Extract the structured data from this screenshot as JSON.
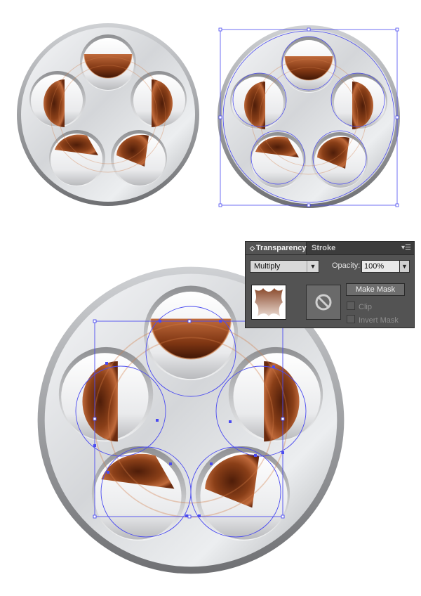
{
  "transparency_panel": {
    "tab_active": "Transparency",
    "tab_inactive": "Stroke",
    "blend_mode": "Multiply",
    "opacity_label": "Opacity:",
    "opacity_value": "100%",
    "make_mask_label": "Make Mask",
    "clip_label": "Clip",
    "clip_checked": false,
    "invert_mask_label": "Invert Mask",
    "invert_mask_checked": false
  },
  "icons": {
    "tab": "double-arrow-icon",
    "menu": "panel-menu-icon",
    "dropdown": "chevron-down-icon",
    "mask": "no-entry-icon"
  },
  "colors": {
    "metal_light": "#eceef0",
    "metal_dark": "#8e8f92",
    "wood_light": "#c06a3b",
    "wood_dark": "#4e1d09",
    "selection": "#4b4bf0",
    "panel_bg": "#535353"
  }
}
